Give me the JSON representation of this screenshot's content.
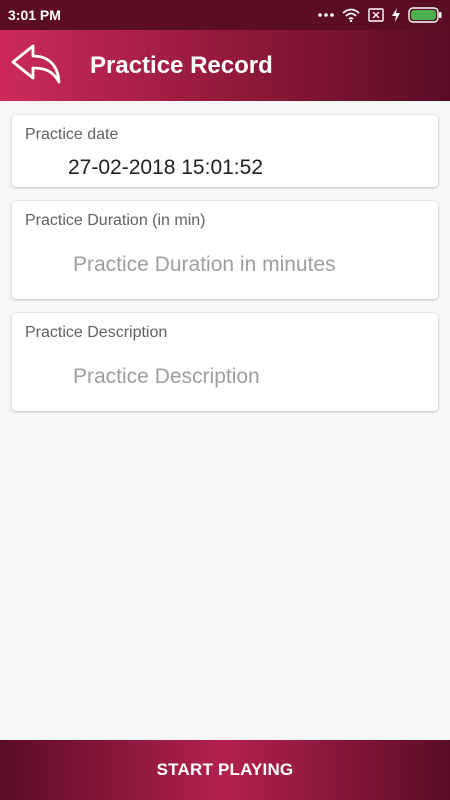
{
  "status_bar": {
    "time": "3:01 PM",
    "icons": [
      "more-dots-icon",
      "wifi-icon",
      "sim-off-icon",
      "charging-icon",
      "battery-icon"
    ]
  },
  "app_bar": {
    "title": "Practice Record",
    "back_icon": "back-arrow-icon"
  },
  "form": {
    "date": {
      "label": "Practice date",
      "value": "27-02-2018 15:01:52"
    },
    "duration": {
      "label": "Practice Duration (in min)",
      "placeholder": "Practice Duration in minutes",
      "value": ""
    },
    "description": {
      "label": "Practice Description",
      "placeholder": "Practice Description",
      "value": ""
    }
  },
  "bottom_button": {
    "label": "START PLAYING"
  },
  "colors": {
    "status_bar": "#5b0d24",
    "accent_light": "#cc2a5c",
    "accent_dark": "#5a0d25",
    "battery": "#4caf50"
  }
}
